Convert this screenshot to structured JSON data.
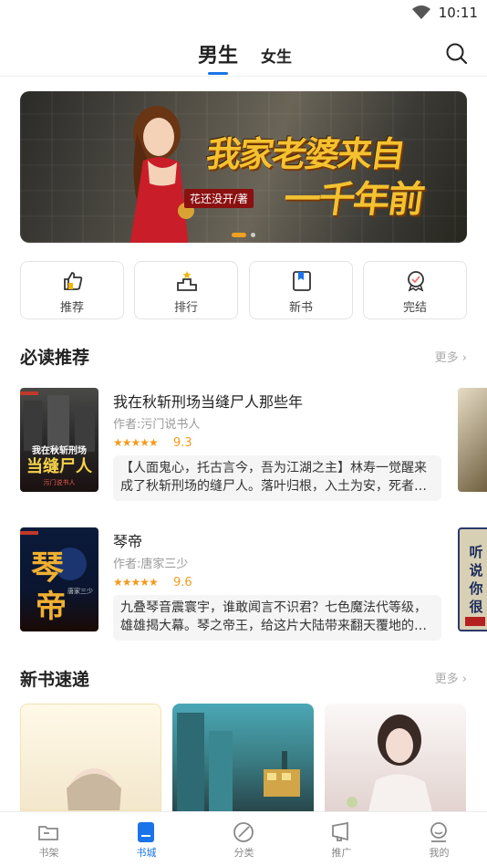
{
  "status_bar": {
    "time": "10:11"
  },
  "top_tabs": {
    "active": "男生",
    "other": "女生"
  },
  "banner": {
    "title_line1": "我家老婆来自",
    "title_line2": "一千年前",
    "author": "花还没开/著"
  },
  "quick_nav": [
    {
      "label": "推荐",
      "icon": "thumbs-up-icon"
    },
    {
      "label": "排行",
      "icon": "podium-icon"
    },
    {
      "label": "新书",
      "icon": "book-icon"
    },
    {
      "label": "完结",
      "icon": "badge-icon"
    }
  ],
  "must_read": {
    "title": "必读推荐",
    "more": "更多",
    "books": [
      {
        "name": "我在秋斩刑场当缝尸人那些年",
        "author": "作者:污门说书人",
        "rating": "9.3",
        "desc": "【人面鬼心，托古言今，吾为江湖之主】林寿一觉醒来成了秋斩刑场的缝尸人。落叶归根，入土为安，死者最后的体面都要经他手缝补完整。",
        "cover_text": "我在秋斩刑场当缝尸人",
        "cover_sub": "污门说书人",
        "cover_colors": [
          "#2d2d2d",
          "#1b1b1b",
          "#c0392b"
        ]
      },
      {
        "name": "琴帝",
        "author": "作者:唐家三少",
        "rating": "9.6",
        "desc": "九叠琴音震寰宇，谁敢闻言不识君？七色魔法代等级，雄雄揭大幕。琴之帝王，给这片大陆带来翻天覆地的变化。",
        "cover_text": "琴帝",
        "cover_sub": "唐家三少",
        "cover_colors": [
          "#0b1b3a",
          "#10284f",
          "#f0b030"
        ]
      }
    ],
    "peek_covers": [
      {
        "colors": [
          "#d9d0bd",
          "#6b5a3a"
        ]
      },
      {
        "colors": [
          "#d8d0b5",
          "#2a3a6a"
        ],
        "text": "听说你很独啊"
      }
    ]
  },
  "new_books": {
    "title": "新书速递",
    "more": "更多",
    "covers": [
      {
        "colors": [
          "#fff8e5",
          "#f4ead0"
        ]
      },
      {
        "colors": [
          "#3fa0b0",
          "#2d5f68"
        ]
      },
      {
        "colors": [
          "#f7f4f4",
          "#d8c6c4"
        ]
      }
    ]
  },
  "bottom_nav": [
    {
      "label": "书架",
      "icon": "bookshelf-icon",
      "active": false
    },
    {
      "label": "书城",
      "icon": "bookstore-icon",
      "active": true
    },
    {
      "label": "分类",
      "icon": "category-icon",
      "active": false
    },
    {
      "label": "推广",
      "icon": "promote-icon",
      "active": false
    },
    {
      "label": "我的",
      "icon": "profile-icon",
      "active": false
    }
  ],
  "colors": {
    "accent": "#1a73e8",
    "rating": "#f29b1f",
    "banner_dot": "#f0a020"
  }
}
